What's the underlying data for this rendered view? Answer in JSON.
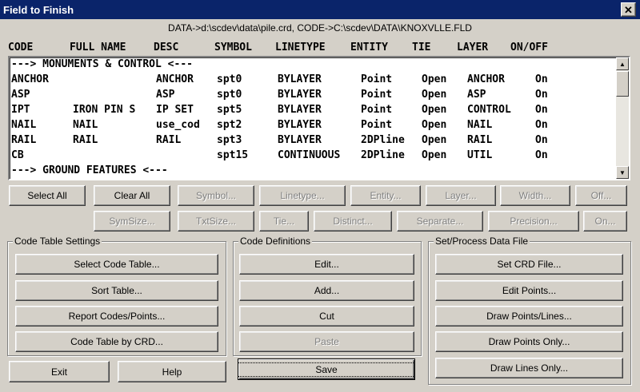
{
  "window": {
    "title": "Field to Finish",
    "close_glyph": "✕"
  },
  "path_info": "DATA->d:\\scdev\\data\\pile.crd, CODE->C:\\scdev\\DATA\\KNOXVLLE.FLD",
  "columns": [
    "CODE",
    "FULL NAME",
    "DESC",
    "SYMBOL",
    "LINETYPE",
    "ENTITY",
    "TIE",
    "LAYER",
    "ON/OFF"
  ],
  "rows": [
    {
      "section": "---> MONUMENTS & CONTROL <---"
    },
    {
      "code": "ANCHOR",
      "full_name": "",
      "desc": "ANCHOR",
      "symbol": "spt0",
      "linetype": "BYLAYER",
      "entity": "Point",
      "tie": "Open",
      "layer": "ANCHOR",
      "onoff": "On"
    },
    {
      "code": "ASP",
      "full_name": "",
      "desc": "ASP",
      "symbol": "spt0",
      "linetype": "BYLAYER",
      "entity": "Point",
      "tie": "Open",
      "layer": "ASP",
      "onoff": "On"
    },
    {
      "code": "IPT",
      "full_name": "IRON PIN S",
      "desc": "IP SET",
      "symbol": "spt5",
      "linetype": "BYLAYER",
      "entity": "Point",
      "tie": "Open",
      "layer": "CONTROL",
      "onoff": "On"
    },
    {
      "code": "NAIL",
      "full_name": "NAIL",
      "desc": "use_cod",
      "symbol": "spt2",
      "linetype": "BYLAYER",
      "entity": "Point",
      "tie": "Open",
      "layer": "NAIL",
      "onoff": "On"
    },
    {
      "code": "RAIL",
      "full_name": "RAIL",
      "desc": "RAIL",
      "symbol": "spt3",
      "linetype": "BYLAYER",
      "entity": "2DPline",
      "tie": "Open",
      "layer": "RAIL",
      "onoff": "On"
    },
    {
      "code": "CB",
      "full_name": "",
      "desc": "",
      "symbol": "spt15",
      "linetype": "CONTINUOUS",
      "entity": "2DPline",
      "tie": "Open",
      "layer": "UTIL",
      "onoff": "On"
    },
    {
      "section": "---> GROUND FEATURES <---"
    }
  ],
  "scroll": {
    "up_glyph": "▲",
    "down_glyph": "▼"
  },
  "toolbar_row1": [
    {
      "label": "Select All",
      "enabled": true
    },
    {
      "label": "Clear All",
      "enabled": true
    },
    {
      "label": "Symbol...",
      "enabled": false
    },
    {
      "label": "Linetype...",
      "enabled": false
    },
    {
      "label": "Entity...",
      "enabled": false
    },
    {
      "label": "Layer...",
      "enabled": false
    },
    {
      "label": "Width...",
      "enabled": false
    },
    {
      "label": "Off...",
      "enabled": false
    }
  ],
  "toolbar_row2": [
    {
      "label": "SymSize...",
      "enabled": false
    },
    {
      "label": "TxtSize...",
      "enabled": false
    },
    {
      "label": "Tie...",
      "enabled": false
    },
    {
      "label": "Distinct...",
      "enabled": false
    },
    {
      "label": "Separate...",
      "enabled": false
    },
    {
      "label": "Precision...",
      "enabled": false
    },
    {
      "label": "On...",
      "enabled": false
    }
  ],
  "code_table_settings": {
    "title": "Code Table Settings",
    "buttons": [
      "Select Code Table...",
      "Sort Table...",
      "Report Codes/Points...",
      "Code Table by CRD..."
    ]
  },
  "code_definitions": {
    "title": "Code Definitions",
    "buttons": [
      {
        "label": "Edit...",
        "enabled": true
      },
      {
        "label": "Add...",
        "enabled": true
      },
      {
        "label": "Cut",
        "enabled": true
      },
      {
        "label": "Paste",
        "enabled": false
      }
    ]
  },
  "set_process": {
    "title": "Set/Process Data File",
    "buttons": [
      "Set CRD File...",
      "Edit Points...",
      "Draw Points/Lines...",
      "Draw Points Only...",
      "Draw Lines Only..."
    ]
  },
  "bottom": {
    "exit": "Exit",
    "help": "Help",
    "save": "Save"
  }
}
